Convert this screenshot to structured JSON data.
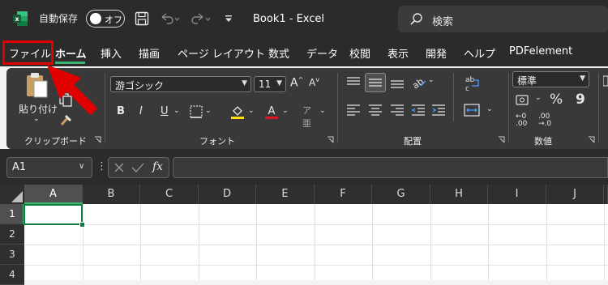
{
  "titlebar": {
    "autosave_label": "自動保存",
    "autosave_state": "オフ",
    "doc_title": "Book1  -  Excel",
    "search_placeholder": "検索"
  },
  "tabs": [
    "ファイル",
    "ホーム",
    "挿入",
    "描画",
    "ページ レイアウト",
    "数式",
    "データ",
    "校閲",
    "表示",
    "開発",
    "ヘルプ",
    "PDFelement"
  ],
  "ribbon": {
    "clipboard": {
      "label": "クリップボード",
      "paste_label": "貼り付け"
    },
    "font": {
      "label": "フォント",
      "font_name": "游ゴシック",
      "font_size": "11",
      "bold": "B",
      "italic": "I",
      "underline": "U"
    },
    "alignment": {
      "label": "配置"
    },
    "number": {
      "label": "数値",
      "format": "標準",
      "percent": "%",
      "comma": "9"
    },
    "colors": {
      "font_color_bar": "#e81123",
      "fill_color_bar": "#ffe100",
      "accent": "#107c41"
    }
  },
  "formula_bar": {
    "name_box": "A1",
    "fx": "fx",
    "formula": ""
  },
  "grid": {
    "columns": [
      "A",
      "B",
      "C",
      "D",
      "E",
      "F",
      "G",
      "H",
      "I",
      "J"
    ],
    "rows": [
      "1",
      "2",
      "3",
      "4"
    ],
    "active_cell": "A1"
  }
}
